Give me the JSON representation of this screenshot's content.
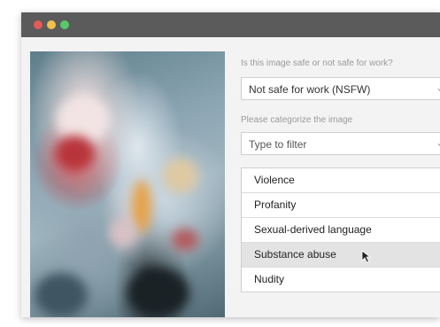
{
  "colors": {
    "window_close": "#e35b57",
    "window_minimize": "#f0c14b",
    "window_maximize": "#58c86b"
  },
  "safety": {
    "label": "Is this image safe or not safe for work?",
    "selected": "Not safe for work (NSFW)"
  },
  "category": {
    "label": "Please categorize the image",
    "placeholder": "Type to filter"
  },
  "categories": [
    {
      "label": "Violence"
    },
    {
      "label": "Profanity"
    },
    {
      "label": "Sexual-derived language"
    },
    {
      "label": "Substance abuse"
    },
    {
      "label": "Nudity"
    }
  ],
  "hovered_category": "Substance abuse"
}
